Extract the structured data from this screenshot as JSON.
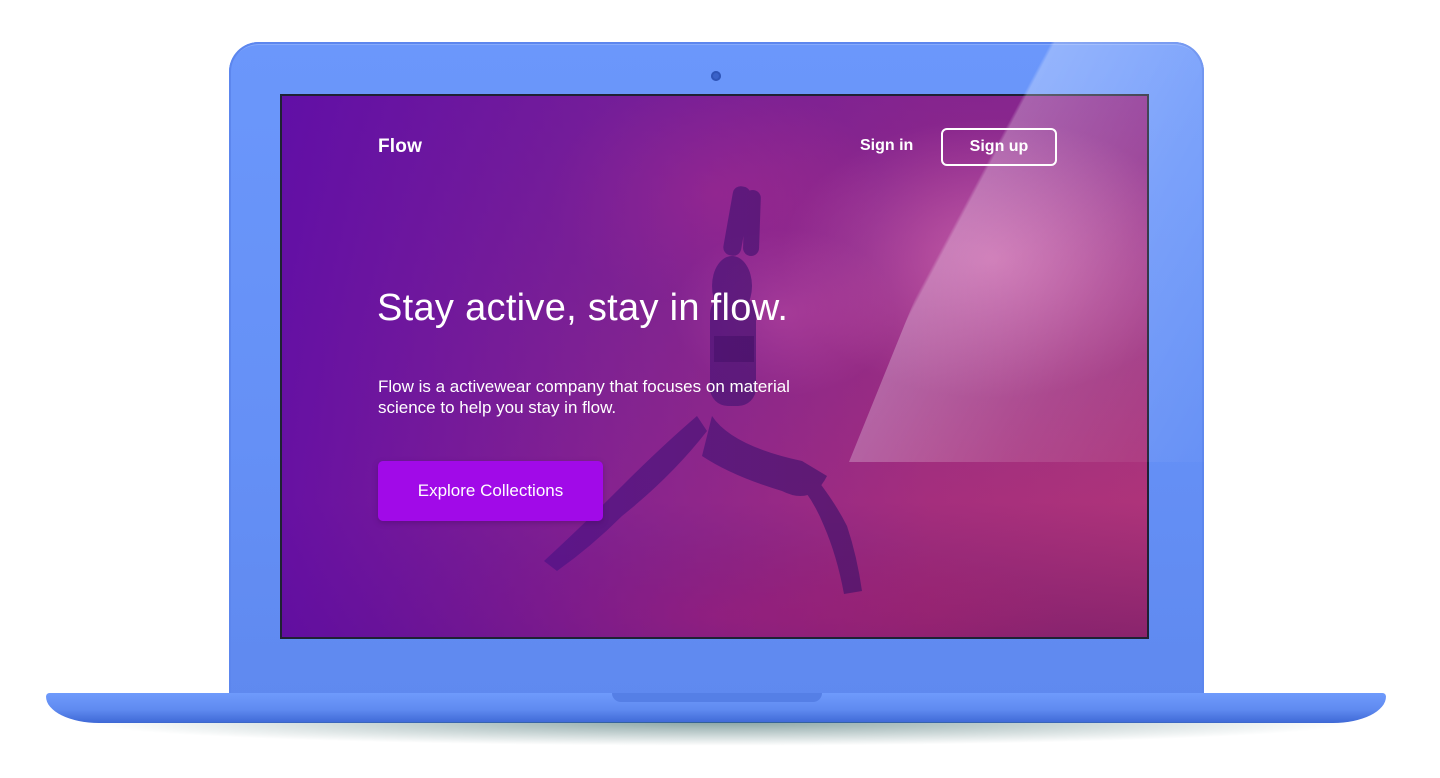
{
  "site": {
    "brand": "Flow",
    "nav": {
      "signin_label": "Sign in",
      "signup_label": "Sign up"
    },
    "hero": {
      "headline": "Stay active, stay in flow.",
      "description": "Flow is a activewear company that focuses on material science to help you stay in flow.",
      "cta_label": "Explore Collections"
    }
  },
  "colors": {
    "device_body": "#6590f6",
    "cta_background": "#a10ae8",
    "overlay_purple": "#5a0aaa",
    "text": "#ffffff"
  },
  "icons": {
    "camera": "webcam-dot"
  }
}
